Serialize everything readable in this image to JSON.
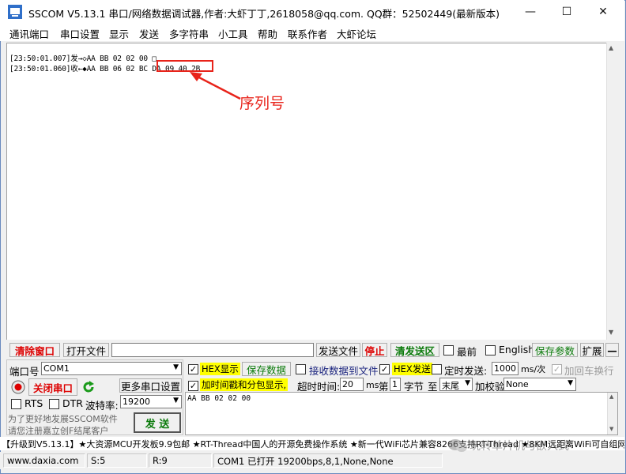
{
  "window": {
    "title": "SSCOM V5.13.1 串口/网络数据调试器,作者:大虾丁丁,2618058@qq.com. QQ群：52502449(最新版本)",
    "min": "—",
    "max": "☐",
    "close": "✕"
  },
  "menu": [
    "通讯端口",
    "串口设置",
    "显示",
    "发送",
    "多字符串",
    "小工具",
    "帮助",
    "联系作者",
    "大虾论坛"
  ],
  "receive": {
    "line1": "[23:50:01.007]发→◇AA BB 02 02 00 □",
    "line2_prefix": "[23:50:01.060]收←◆AA BB 06 02 ",
    "line2_highlight": "BC DA 09 40",
    "line2_suffix": " 2B"
  },
  "annotation": {
    "label": "序列号",
    "color": "#e8231a"
  },
  "toolbar": {
    "clear_window": "清除窗口",
    "open_file": "打开文件",
    "send_file": "发送文件",
    "stop": "停止",
    "clear_send": "清发送区",
    "topmost": "最前",
    "english": "English",
    "save_params": "保存参数",
    "expand": "扩展",
    "collapse": "—"
  },
  "port": {
    "port_label": "端口号",
    "port_value": "COM1",
    "close_port": "关闭串口",
    "more_settings": "更多串口设置",
    "rts": "RTS",
    "dtr": "DTR",
    "baud_label": "波特率:",
    "baud_value": "19200",
    "promo1": "为了更好地发展SSCOM软件",
    "promo2": "请您注册嘉立创F结尾客户",
    "send": "发  送"
  },
  "options": {
    "hex_display": "HEX显示",
    "save_data": "保存数据",
    "recv_to_file": "接收数据到文件",
    "hex_send": "HEX发送",
    "timed_send": "定时发送:",
    "interval_value": "1000",
    "interval_unit": "ms/次",
    "append_crlf": "加回车换行",
    "timestamp": "加时间戳和分包显示,",
    "timeout_label": "超时时间:",
    "timeout_value": "20",
    "timeout_unit": "ms",
    "byte_prefix": "第",
    "byte_value": "1",
    "byte_suffix": "字节",
    "to_label": "至",
    "to_value": "末尾",
    "checksum_label": "加校验",
    "checksum_value": "None"
  },
  "send_area": {
    "content": "AA BB 02 02 00"
  },
  "ticker": "【升级到V5.13.1】★大资源MCU开发板9.9包邮 ★RT-Thread中国人的开源免费操作系统 ★新一代WiFi芯片兼容8266支持RT-Thread ★8KM远距离WiFi可自组网",
  "status": {
    "website": "www.daxia.com",
    "sent": "S:5",
    "received": "R:9",
    "port_status": "COM1 已打开  19200bps,8,1,None,None"
  },
  "watermark": "玩转单片机与嵌入式"
}
